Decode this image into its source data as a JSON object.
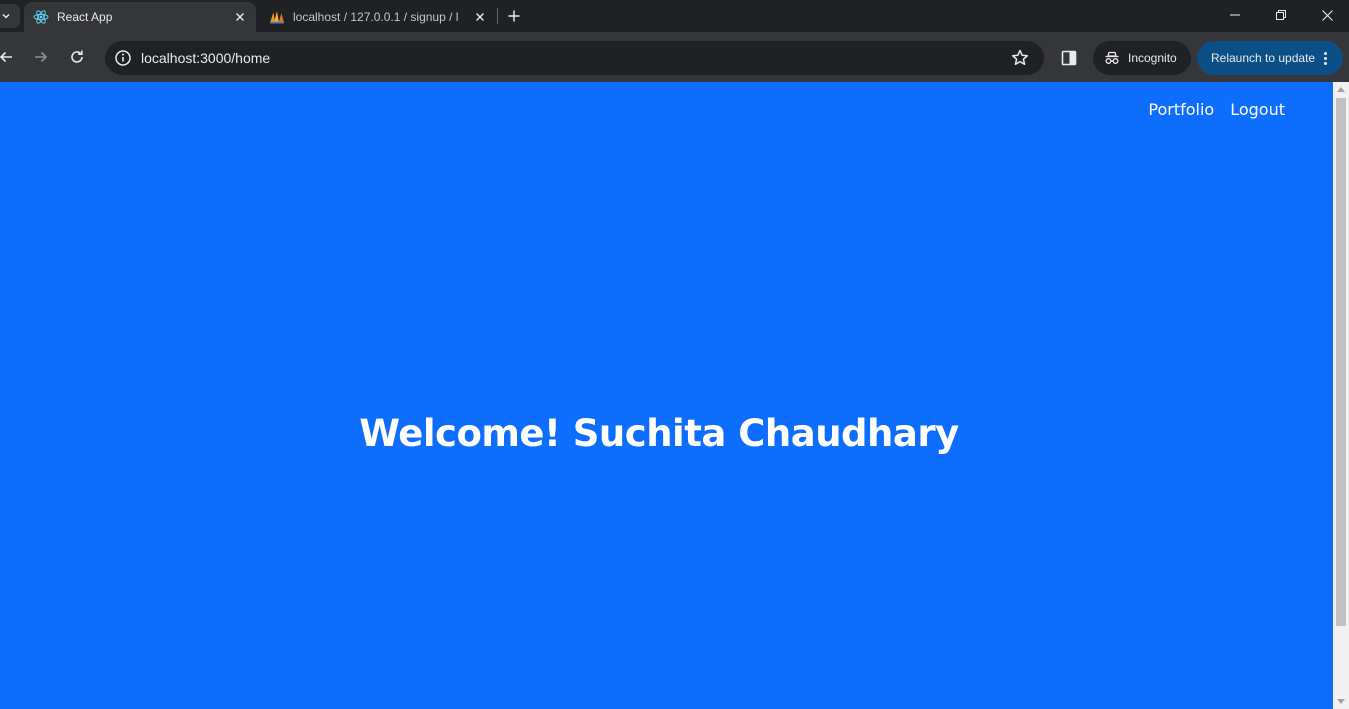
{
  "browser": {
    "tabs": [
      {
        "title": "React App",
        "favicon": "react-logo-icon",
        "active": true
      },
      {
        "title": "localhost / 127.0.0.1 / signup / l",
        "favicon": "phpmyadmin-icon",
        "active": false
      }
    ],
    "address_bar": {
      "url": "localhost:3000/home"
    },
    "incognito_label": "Incognito",
    "relaunch_label": "Relaunch to update",
    "colors": {
      "frame": "#202124",
      "toolbar": "#35363a",
      "relaunch_bg": "#0b4f86"
    }
  },
  "page": {
    "background": "#0d6efd",
    "nav": {
      "portfolio": "Portfolio",
      "logout": "Logout"
    },
    "welcome_text": "Welcome! Suchita Chaudhary"
  }
}
